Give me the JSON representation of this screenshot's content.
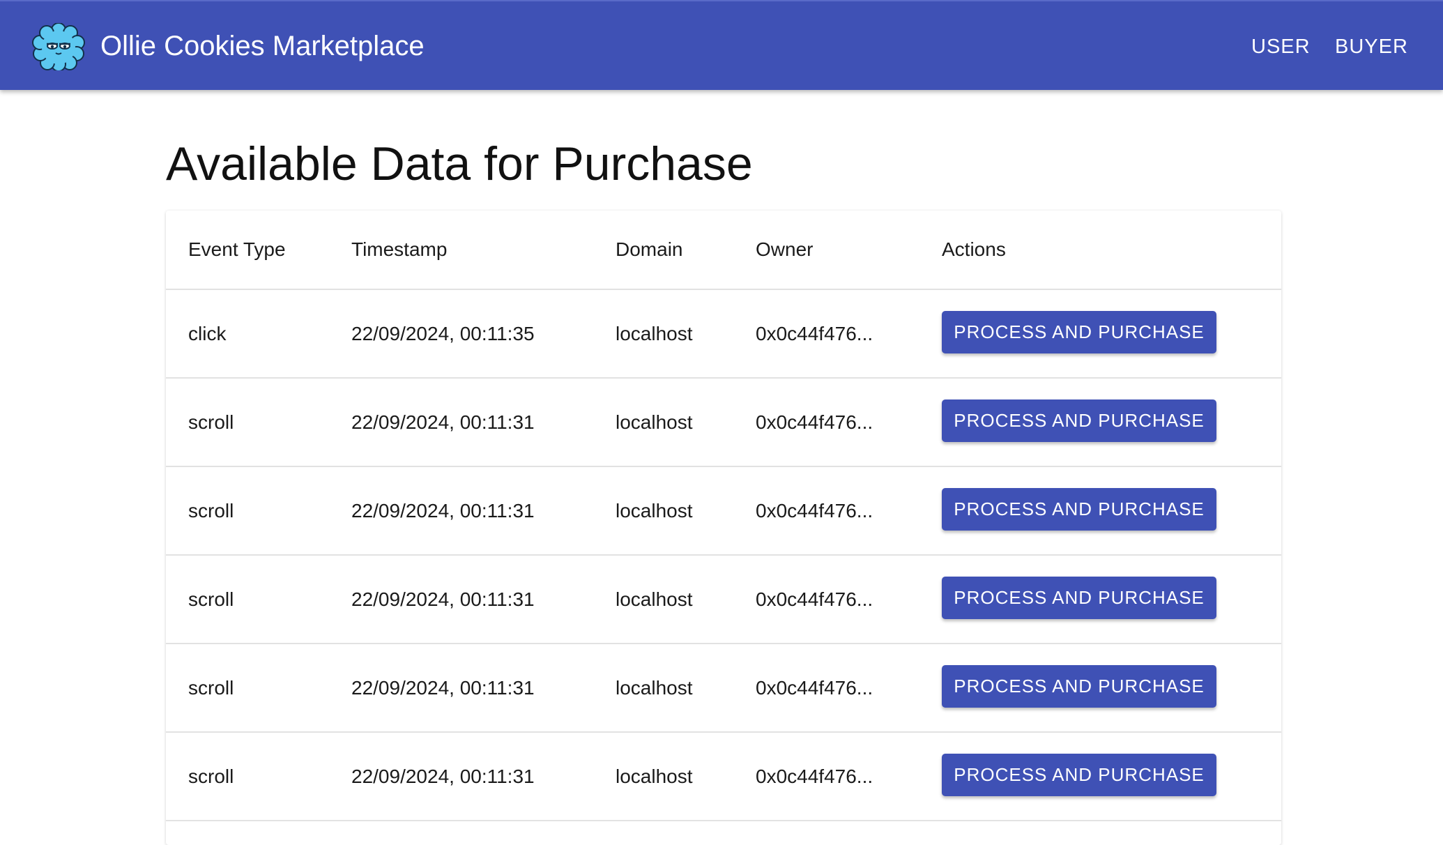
{
  "header": {
    "logo_icon": "ollie-cookie-logo-icon",
    "title": "Ollie Cookies Marketplace",
    "nav": [
      "USER",
      "BUYER"
    ],
    "bar_color": "#3f51b5"
  },
  "main": {
    "title": "Available Data for Purchase",
    "columns": [
      "Event Type",
      "Timestamp",
      "Domain",
      "Owner",
      "Actions"
    ],
    "rows": [
      {
        "event_type": "click",
        "timestamp": "22/09/2024, 00:11:35",
        "domain": "localhost",
        "owner": "0x0c44f476...",
        "action": "PROCESS AND PURCHASE"
      },
      {
        "event_type": "scroll",
        "timestamp": "22/09/2024, 00:11:31",
        "domain": "localhost",
        "owner": "0x0c44f476...",
        "action": "PROCESS AND PURCHASE"
      },
      {
        "event_type": "scroll",
        "timestamp": "22/09/2024, 00:11:31",
        "domain": "localhost",
        "owner": "0x0c44f476...",
        "action": "PROCESS AND PURCHASE"
      },
      {
        "event_type": "scroll",
        "timestamp": "22/09/2024, 00:11:31",
        "domain": "localhost",
        "owner": "0x0c44f476...",
        "action": "PROCESS AND PURCHASE"
      },
      {
        "event_type": "scroll",
        "timestamp": "22/09/2024, 00:11:31",
        "domain": "localhost",
        "owner": "0x0c44f476...",
        "action": "PROCESS AND PURCHASE"
      },
      {
        "event_type": "scroll",
        "timestamp": "22/09/2024, 00:11:31",
        "domain": "localhost",
        "owner": "0x0c44f476...",
        "action": "PROCESS AND PURCHASE"
      }
    ]
  }
}
